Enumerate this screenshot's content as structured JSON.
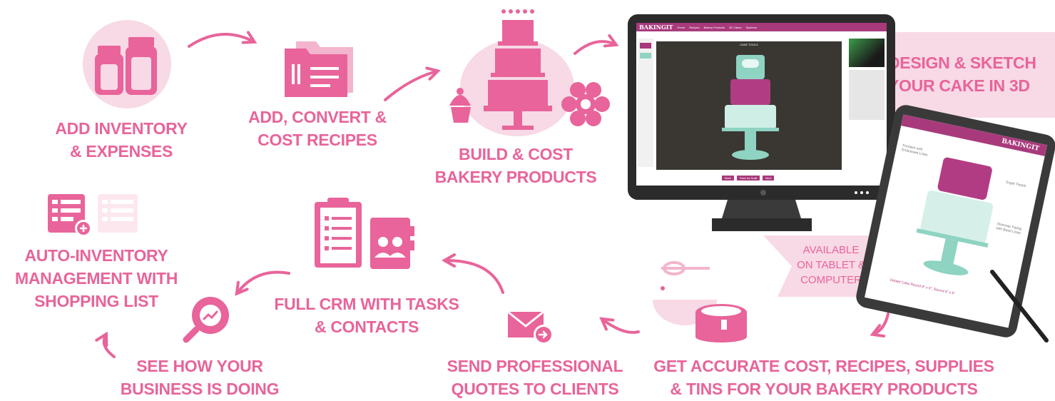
{
  "colors": {
    "pink": "#e8649a",
    "light_pink": "#f8d9e6",
    "dark": "#2b2b2b",
    "teal": "#8fd3c2",
    "magenta": "#b23c83"
  },
  "steps": {
    "inventory": {
      "line1": "ADD INVENTORY",
      "line2": "& EXPENSES",
      "icon": "jars-icon"
    },
    "recipes": {
      "line1": "ADD, CONVERT &",
      "line2": "COST RECIPES",
      "icon": "recipe-folder-icon"
    },
    "products": {
      "line1": "BUILD & COST",
      "line2": "BAKERY PRODUCTS",
      "icon": "cake-stand-icon"
    },
    "design": {
      "line1": "DESIGN & SKETCH",
      "line2": "YOUR CAKE IN 3D"
    },
    "available": {
      "line1": "AVAILABLE",
      "line2": "ON TABLET &",
      "line3": "COMPUTER"
    },
    "accurate": {
      "line1": "GET ACCURATE COST, RECIPES, SUPPLIES",
      "line2": "& TINS FOR YOUR BAKERY PRODUCTS",
      "icon": "cake-tin-icon"
    },
    "quotes": {
      "line1": "SEND PROFESSIONAL",
      "line2": "QUOTES TO CLIENTS",
      "icon": "email-send-icon"
    },
    "crm": {
      "line1": "FULL CRM WITH TASKS",
      "line2": "& CONTACTS",
      "icon": "clipboard-contacts-icon"
    },
    "business": {
      "line1": "SEE HOW YOUR",
      "line2": "BUSINESS IS DOING",
      "icon": "analytics-search-icon"
    },
    "auto_inventory": {
      "line1": "AUTO-INVENTORY",
      "line2": "MANAGEMENT WITH",
      "line3": "SHOPPING LIST",
      "icon": "shopping-list-icon"
    }
  },
  "monitor_app": {
    "brand": "BAKINGIT",
    "nav": [
      "Home",
      "Recipes",
      "Bakery Products",
      "3D Cakes",
      "Systems"
    ],
    "toolbar_label": "CAKE TOOLS",
    "buttons": [
      "Back",
      "Save as Draft",
      "Next"
    ]
  },
  "tablet_app": {
    "brand": "BAKINGIT",
    "annotations": [
      "Fondant with Embossed Lines",
      "Sugar Pearls",
      "Shimmer Piping with Bead Lines"
    ],
    "caption": "Dotted Cake Round 8\" x 6\", Round 6\" x 6\""
  }
}
